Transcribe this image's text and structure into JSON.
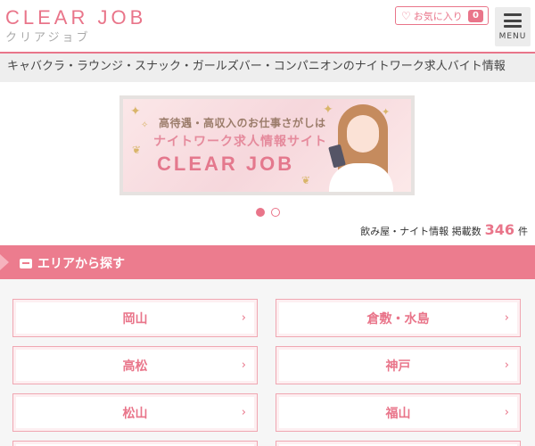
{
  "header": {
    "logo_main": "CLEAR JOB",
    "logo_sub": "クリアジョブ",
    "favorites_label": "お気に入り",
    "favorites_count": "0",
    "menu_label": "MENU"
  },
  "tagline": "キャバクラ・ラウンジ・スナック・ガールズバー・コンパニオンのナイトワーク求人バイト情報",
  "banner": {
    "line1": "高待遇・高収入のお仕事さがしは",
    "line2": "ナイトワーク求人情報サイト",
    "logo": "CLEAR JOB"
  },
  "slider": {
    "total": 2,
    "active": 1
  },
  "listing_count": {
    "prefix": "飲み屋・ナイト情報 掲載数",
    "number": "346",
    "unit": "件"
  },
  "section": {
    "title": "エリアから探す"
  },
  "areas": [
    {
      "label": "岡山"
    },
    {
      "label": "倉敷・水島"
    },
    {
      "label": "高松"
    },
    {
      "label": "神戸"
    },
    {
      "label": "松山"
    },
    {
      "label": "福山"
    }
  ],
  "colors": {
    "accent": "#e9758a",
    "section_bg": "#ec7c8e",
    "tagline_bg": "#eeeeee"
  },
  "icons": [
    "heart-icon",
    "hamburger-menu-icon",
    "card-icon",
    "chevron-right-icon"
  ]
}
